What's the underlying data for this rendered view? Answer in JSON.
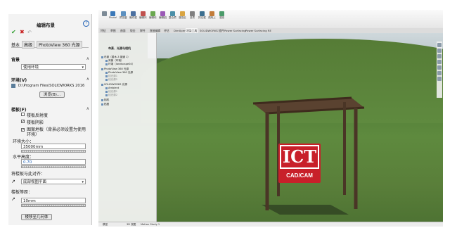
{
  "panel": {
    "title": "编辑布景",
    "tabs": [
      "基本",
      "高级",
      "PhotoView 360 光源"
    ],
    "background_section": "背景",
    "background_value": "使用环境",
    "environment_section": "环境(V)",
    "environment_path": "D:\\Program Files\\SOLIDWORKS 2016",
    "browse_label": "浏览(B)...",
    "floor_section": "楼板(F)",
    "floor_reflection": "楼板反射度",
    "floor_shadow": "楼板阴影",
    "flatten_floor": "图案地板（背景必须设置为使用环境）",
    "env_size_label": "环境大小：",
    "env_size_value": "35000mm",
    "horizon_label": "水平高度：",
    "horizon_value": "0.70",
    "align_label": "将楼板与此对齐：",
    "align_value": "底部视图平面",
    "offset_label": "楼板等距：",
    "offset_value": "10mm",
    "flip_label": "楼移至几何体"
  },
  "toolbar": {
    "tools": [
      "",
      "PhotoView 360",
      "预览窗口",
      "最终渲染",
      "编辑外观",
      "编辑布景",
      "编辑贴图",
      "整合预览",
      "渲染区域",
      "选项",
      "排定渲染",
      "调用上次渲染的图像",
      "渲染"
    ],
    "tabs": [
      "特征",
      "草图",
      "曲面",
      "钣金",
      "焊件",
      "直接编辑",
      "评估",
      "DimXpert",
      "渲染工具",
      "SOLIDWORKS 插件",
      "Power Surfacing",
      "Power Surfacing RE"
    ]
  },
  "tree": {
    "header": "布景、光源与相机",
    "items": [
      "布景（楼木-3 普通 1）",
      "背景（环境）",
      "环境（landscape04）",
      "PhotoView 360 光源",
      "PhotoView 360 光源",
      "线光源1",
      "线光源2",
      "SOLIDWORKS 光源",
      "Ambient",
      "线光源1",
      "线光源2",
      "相机",
      "贴图"
    ]
  },
  "status": [
    "模型",
    "3D 视图",
    "Motion Study 1"
  ],
  "logo": {
    "top": "ICT",
    "bottom": "CAD/CAM",
    "color": "#c8202a"
  },
  "colors": {
    "ok": "#2a9d2a",
    "cancel": "#c82020",
    "help": "#1d5fb5"
  }
}
